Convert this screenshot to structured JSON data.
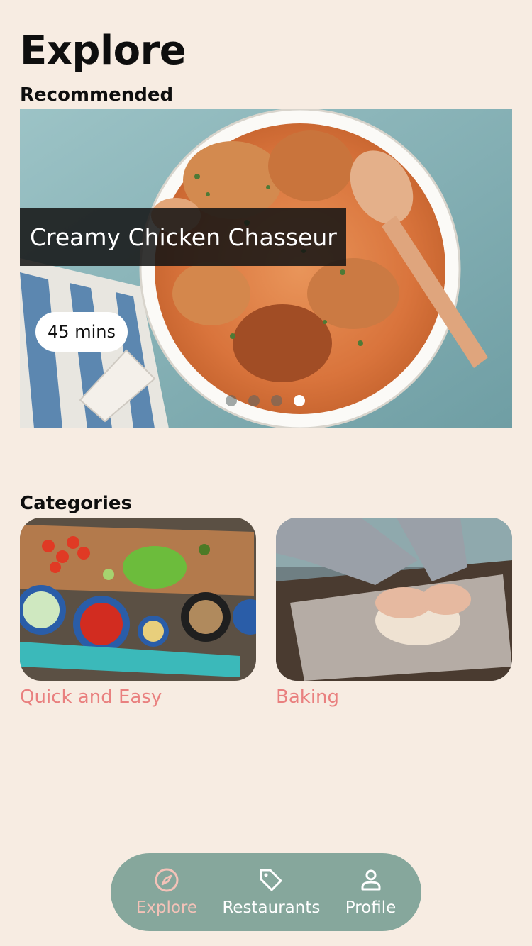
{
  "header": {
    "title": "Explore"
  },
  "recommended": {
    "section_label": "Recommended",
    "card": {
      "title": "Creamy Chicken Chasseur",
      "time": "45 mins",
      "dots_total": 4,
      "active_dot_index": 3
    }
  },
  "categories": {
    "section_label": "Categories",
    "items": [
      {
        "label": "Quick and Easy",
        "image_icon": "vegetables-board-image"
      },
      {
        "label": "Baking",
        "image_icon": "dough-kneading-image"
      }
    ]
  },
  "bottom_nav": {
    "items": [
      {
        "label": "Explore",
        "icon": "compass-icon",
        "active": true
      },
      {
        "label": "Restaurants",
        "icon": "tag-icon",
        "active": false
      },
      {
        "label": "Profile",
        "icon": "person-icon",
        "active": false
      }
    ]
  },
  "colors": {
    "background": "#f7ece2",
    "accent": "#e9807f",
    "nav_bg": "#86a79c",
    "nav_active": "#f4c2b8"
  }
}
